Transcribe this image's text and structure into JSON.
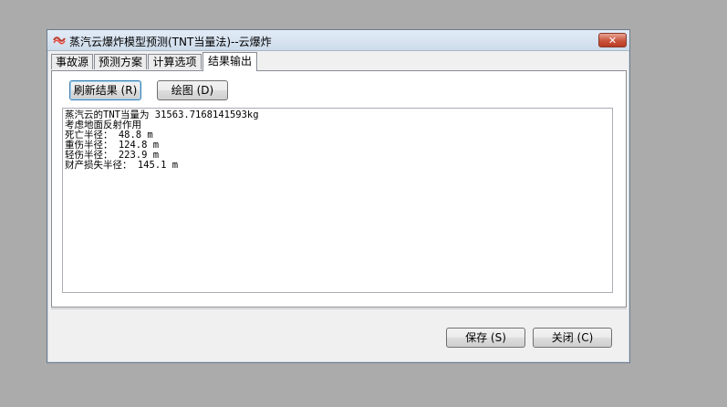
{
  "window": {
    "title": "蒸汽云爆炸模型预测(TNT当量法)--云爆炸",
    "close_glyph": "✕"
  },
  "tabs": [
    {
      "label": "事故源"
    },
    {
      "label": "预测方案"
    },
    {
      "label": "计算选项"
    },
    {
      "label": "结果输出"
    }
  ],
  "active_tab": "结果输出",
  "buttons": {
    "refresh": "刷新结果 (R)",
    "plot": "绘图 (D)",
    "save": "保存 (S)",
    "close": "关闭 (C)"
  },
  "output_lines": [
    "蒸汽云的TNT当量为 31563.7168141593kg",
    "考虑地面反射作用",
    "死亡半径： 48.8 m",
    "重伤半径： 124.8 m",
    "轻伤半径： 223.9 m",
    "财产损失半径： 145.1 m"
  ],
  "colors": {
    "desktop": "#ababab",
    "window_bg": "#f0f0f0",
    "close_button": "#c9543b"
  }
}
